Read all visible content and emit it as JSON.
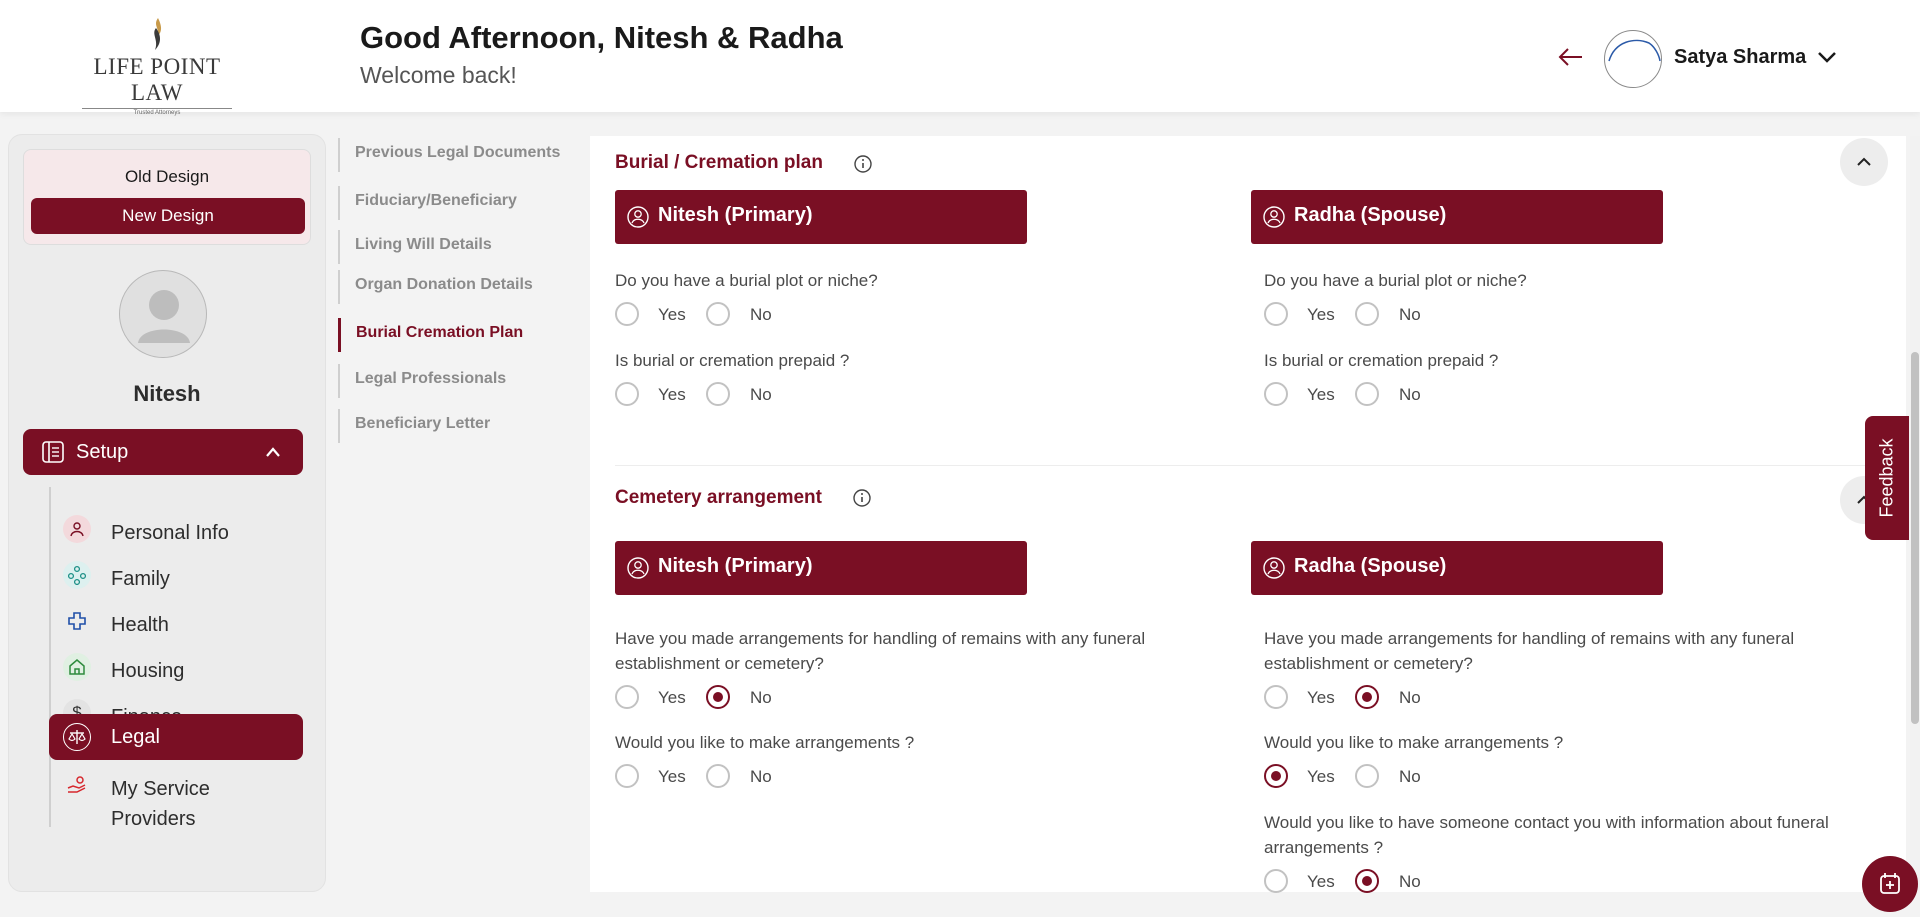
{
  "brand": {
    "name": "LIFE POINT LAW",
    "tagline": "Trusted Attorneys",
    "accent": "#7a0f24"
  },
  "header": {
    "greeting": "Good Afternoon, Nitesh & Radha",
    "subtitle": "Welcome back!",
    "user_name": "Satya Sharma"
  },
  "sidebar": {
    "old_design": "Old Design",
    "new_design": "New Design",
    "profile_name": "Nitesh",
    "setup_label": "Setup",
    "items": [
      {
        "label": "Personal Info",
        "icon": "person-icon"
      },
      {
        "label": "Family",
        "icon": "family-icon"
      },
      {
        "label": "Health",
        "icon": "health-cross-icon"
      },
      {
        "label": "Housing",
        "icon": "home-icon"
      },
      {
        "label": "Finance",
        "icon": "dollar-icon"
      },
      {
        "label": "Legal",
        "icon": "scales-icon",
        "active": true
      },
      {
        "label": "My Service Providers",
        "icon": "service-hand-icon"
      }
    ]
  },
  "subnav": {
    "items": [
      {
        "label": "Previous Legal Documents"
      },
      {
        "label": "Fiduciary/Beneficiary"
      },
      {
        "label": "Living Will Details"
      },
      {
        "label": "Organ Donation Details"
      },
      {
        "label": "Burial Cremation Plan",
        "active": true
      },
      {
        "label": "Legal Professionals"
      },
      {
        "label": "Beneficiary Letter"
      }
    ]
  },
  "burial_section": {
    "title": "Burial / Cremation plan",
    "primary": "Nitesh (Primary)",
    "spouse": "Radha (Spouse)",
    "q1": "Do you have a burial plot or niche?",
    "q2": "Is burial or cremation prepaid ?",
    "primary_answers": {
      "q1": null,
      "q2": null
    },
    "spouse_answers": {
      "q1": null,
      "q2": null
    }
  },
  "cemetery_section": {
    "title": "Cemetery arrangement",
    "primary": "Nitesh (Primary)",
    "spouse": "Radha (Spouse)",
    "q1": "Have you made arrangements for handling of remains with any funeral establishment or cemetery?",
    "q2": "Would you like to make arrangements ?",
    "q3": "Would you like to have someone contact you with information about funeral arrangements ?",
    "primary_answers": {
      "q1": "No",
      "q2": null
    },
    "spouse_answers": {
      "q1": "No",
      "q2": "Yes",
      "q3": "No"
    }
  },
  "options": {
    "yes": "Yes",
    "no": "No"
  },
  "feedback_label": "Feedback"
}
